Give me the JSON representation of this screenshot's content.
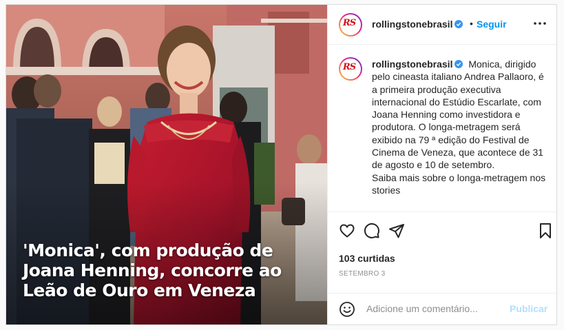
{
  "header": {
    "username": "rollingstonebrasil",
    "separator": "•",
    "follow_label": "Seguir",
    "avatar_logo": "RS",
    "more_icon": "more-horizontal-icon",
    "verified_icon": "verified-badge-icon"
  },
  "media": {
    "overlay_lines": [
      "'Monica', com produção de",
      "Joana Henning, concorre ao",
      "Leão de Ouro em Veneza"
    ]
  },
  "caption": {
    "username": "rollingstonebrasil",
    "text": "Monica, dirigido pelo cineasta italiano Andrea Pallaoro, é a primeira produção executiva internacional do Estúdio Escarlate, com Joana Henning como investidora e produtora. O longa-metragem será exibido na 79 ª edição do Festival de Cinema de Veneza, que acontece de 31 de agosto e 10 de setembro.",
    "text2": "Saiba mais sobre o longa-metragem nos stories"
  },
  "actions": {
    "like_icon": "heart-icon",
    "comment_icon": "comment-icon",
    "share_icon": "share-icon",
    "save_icon": "bookmark-icon",
    "likes": "103 curtidas",
    "date": "SETEMBRO 3"
  },
  "comment": {
    "emoji_icon": "emoji-icon",
    "placeholder": "Adicione um comentário...",
    "publish_label": "Publicar"
  },
  "colors": {
    "accent": "#0095f6",
    "publish_disabled": "#b2dffc",
    "dress": "#b0152a",
    "brand": "#d1121a"
  }
}
